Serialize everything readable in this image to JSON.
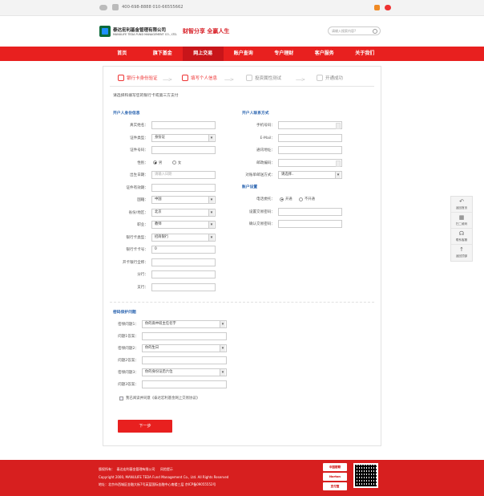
{
  "topbar": {
    "phone": "400-698-8888 010-66555662"
  },
  "header": {
    "company_cn": "泰达宏利基金管理有限公司",
    "company_en": "MANULIFE TEDA FUND MANAGEMENT CO., LTD.",
    "slogan": "财智分享 全赢人生",
    "search_placeholder": "请输入搜索内容?"
  },
  "nav": [
    "首页",
    "旗下基金",
    "网上交易",
    "账户查询",
    "专户理财",
    "客户服务",
    "关于我们"
  ],
  "steps": [
    "银行卡身份验证",
    "填写个人信息",
    "投资属性测试",
    "开通成功"
  ],
  "note": "请选择和填写您的银行卡或第三方支付",
  "left_title": "开户人身份信息",
  "right_title": "开户人联系方式",
  "acct_title": "账户设置",
  "left_rows": [
    {
      "label": "真实姓名：",
      "value": ""
    },
    {
      "label": "证件类型：",
      "value": "身份证"
    },
    {
      "label": "证件号码：",
      "value": ""
    },
    {
      "label": "性别：",
      "value": ""
    },
    {
      "label": "出生日期：",
      "value": "请输入日期"
    },
    {
      "label": "证件有效期：",
      "value": ""
    },
    {
      "label": "国籍：",
      "value": "中国"
    },
    {
      "label": "省份/地区：",
      "value": "北京"
    },
    {
      "label": "职业：",
      "value": "教师"
    },
    {
      "label": "银行卡类型：",
      "value": "招商银行"
    },
    {
      "label": "银行卡卡号：",
      "value": "0"
    },
    {
      "label": "开卡银行全称：",
      "value": ""
    },
    {
      "label": "分行：",
      "value": ""
    },
    {
      "label": "支行：",
      "value": ""
    }
  ],
  "gender": [
    "男",
    "女"
  ],
  "right_rows": [
    {
      "label": "手机号码：",
      "value": ""
    },
    {
      "label": "E-Mail：",
      "value": ""
    },
    {
      "label": "通讯地址：",
      "value": ""
    },
    {
      "label": "邮政编码：",
      "value": ""
    },
    {
      "label": "对账单邮送方式：",
      "value": "请选择.."
    }
  ],
  "acct_rows": [
    {
      "label": "电话委托：",
      "value": ""
    },
    {
      "label": "设置交易密码：",
      "value": ""
    },
    {
      "label": "确认交易密码：",
      "value": ""
    }
  ],
  "phone_delegate": [
    "开通",
    "不开通"
  ],
  "security_title": "密码保护问题",
  "security_rows": [
    {
      "label": "密保问题1：",
      "value": "你的高中班主任名字"
    },
    {
      "label": "问题1答案：",
      "value": ""
    },
    {
      "label": "密保问题2：",
      "value": "你的生日"
    },
    {
      "label": "问题2答案：",
      "value": ""
    },
    {
      "label": "密保问题3：",
      "value": "你的身份证后六位"
    },
    {
      "label": "问题3答案：",
      "value": ""
    }
  ],
  "agree": "我已阅读并同意《泰达宏利基金网上交易协议》",
  "next": "下一步",
  "side": [
    "返回首页",
    "扫二维码",
    "联系客服",
    "返回顶部"
  ],
  "footer": {
    "l1a": "版权所有：",
    "l1b": "泰达宏利基金管理有限公司",
    "l1c": "风险提示",
    "l2": "Copyright 2000, MANULIFE TEDA Fund Management Co., Ltd. All Rights Reserved",
    "l3": "地址：北京市西城区金融大街7号英蓝国际金融中心南楼三层 京ICP备09055552号",
    "badges": [
      "中国银联",
      "Norton",
      "支付宝"
    ]
  }
}
